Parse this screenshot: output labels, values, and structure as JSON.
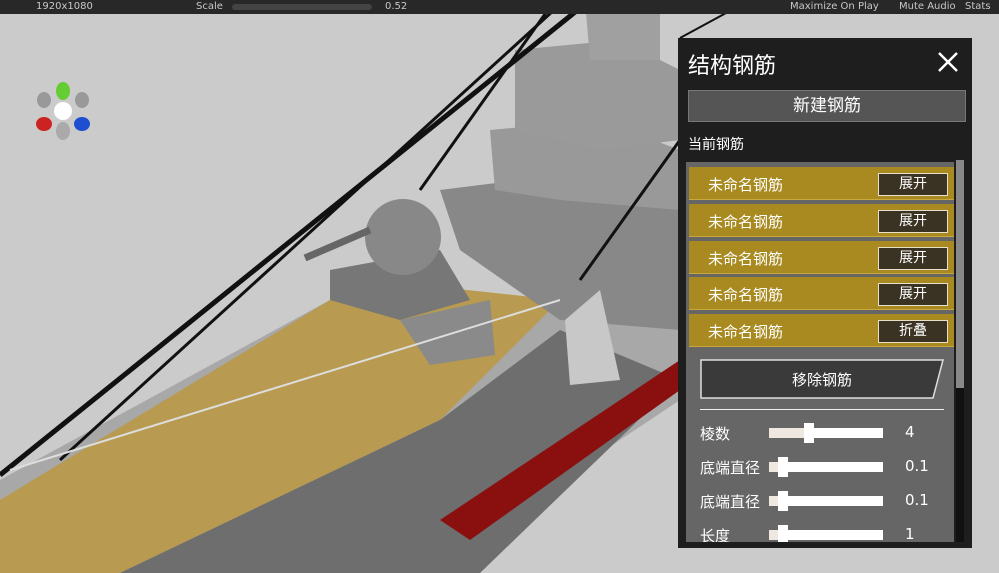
{
  "toolbar": {
    "resolution": "1920x1080",
    "scale_label": "Scale",
    "scale_value": "0.52",
    "maximize": "Maximize On Play",
    "mute": "Mute Audio",
    "stats": "Stats"
  },
  "panel": {
    "title": "结构钢筋",
    "new_button": "新建钢筋",
    "current_label": "当前钢筋",
    "rebars": [
      {
        "name": "未命名钢筋",
        "action": "展开"
      },
      {
        "name": "未命名钢筋",
        "action": "展开"
      },
      {
        "name": "未命名钢筋",
        "action": "展开"
      },
      {
        "name": "未命名钢筋",
        "action": "展开"
      },
      {
        "name": "未命名钢筋",
        "action": "折叠"
      }
    ],
    "remove_button": "移除钢筋",
    "sliders": [
      {
        "label": "棱数",
        "value": "4",
        "fraction": 0.35
      },
      {
        "label": "底端直径",
        "value": "0.1",
        "fraction": 0.12
      },
      {
        "label": "底端直径",
        "value": "0.1",
        "fraction": 0.12
      },
      {
        "label": "长度",
        "value": "1",
        "fraction": 0.12
      }
    ]
  },
  "colors": {
    "row": "#a88a20",
    "deck": "#b89a50",
    "hull": "#8a8a8a"
  }
}
